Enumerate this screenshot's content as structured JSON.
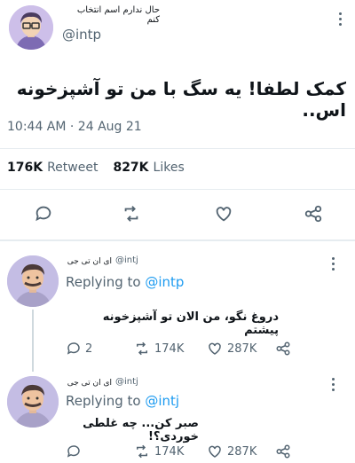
{
  "main_tweet": {
    "display_name": "حال ندارم اسم انتخاب کنم",
    "handle": "@intp",
    "text": "کمک لطفا! یه سگ با من تو آشپزخونه اس..",
    "timestamp": "10:44 AM · 24 Aug 21",
    "retweets_count": "176K",
    "retweets_label": "Retweet",
    "likes_count": "827K",
    "likes_label": "Likes"
  },
  "replies": [
    {
      "display_name": "ای ان تی جی",
      "handle": "@intj",
      "replying_label": "Replying to",
      "replying_to": "@intp",
      "text": "دروغ نگو، من الان تو آشپزخونه پیشتم",
      "reply_count": "2",
      "retweet_count": "174K",
      "like_count": "287K"
    },
    {
      "display_name": "ای ان تی جی",
      "handle": "@intj",
      "replying_label": "Replying to",
      "replying_to": "@intj",
      "text": "صبر کن... چه غلطی خوردی؟!",
      "reply_count": "",
      "retweet_count": "174K",
      "like_count": "287K"
    }
  ],
  "colors": {
    "accent": "#1d9bf0",
    "muted": "#536471",
    "divider": "#e6ecf0",
    "avatar_bg": "#c9c1e8"
  },
  "icons": [
    "reply-icon",
    "retweet-icon",
    "like-icon",
    "share-icon",
    "more-icon"
  ]
}
